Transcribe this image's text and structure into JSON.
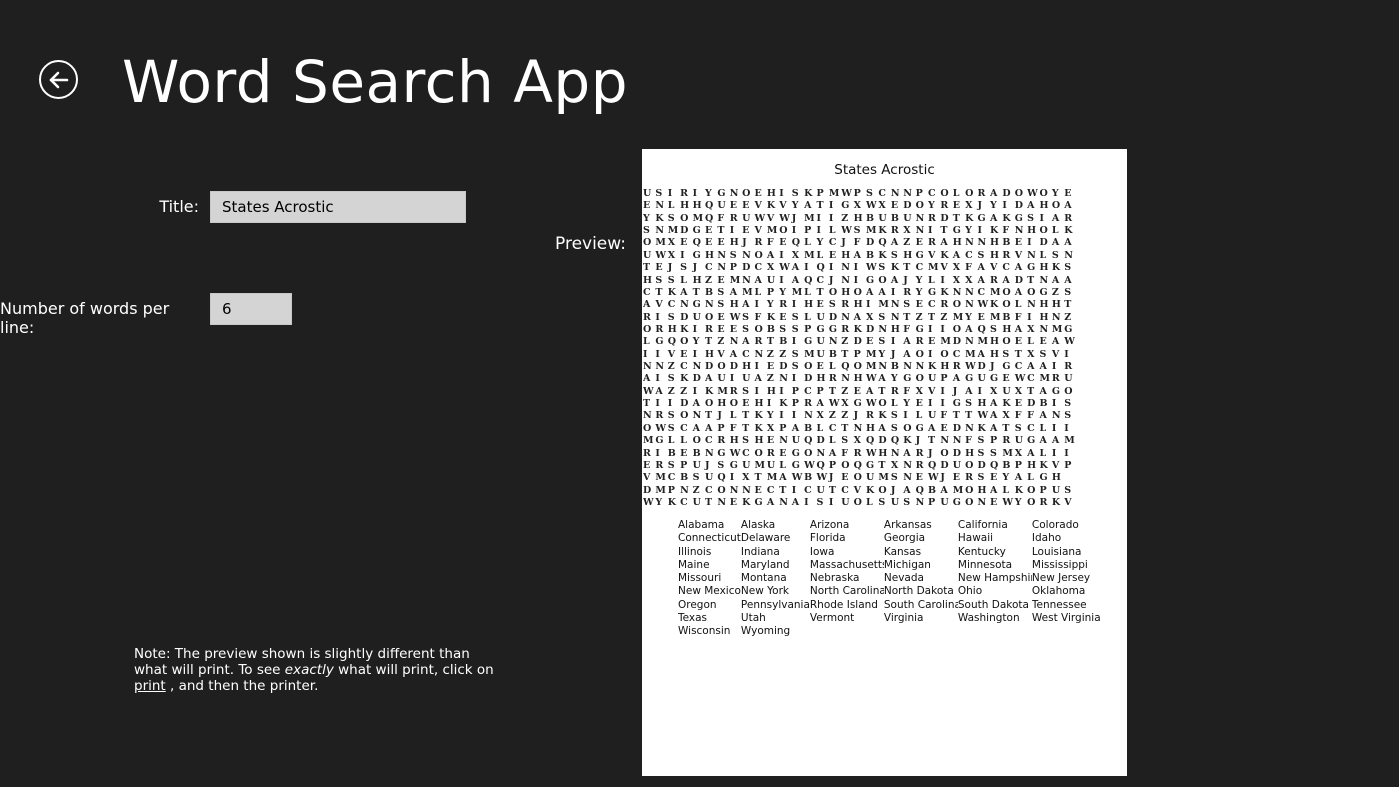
{
  "header": {
    "title": "Word Search App",
    "back_icon": "back-arrow-circle-icon"
  },
  "form": {
    "title_label": "Title:",
    "title_value": "States Acrostic",
    "words_label": "Number of words per line:",
    "words_value": "6",
    "preview_label": "Preview:"
  },
  "note": {
    "part1": "Note: The preview shown is slightly different than what will print. To see ",
    "emphasis": "exactly",
    "part2": " what will print, click on ",
    "link": "print",
    "part3": " , and then the printer."
  },
  "preview": {
    "title": "States Acrostic",
    "grid": [
      "USIRIYGNOEHISKPMWPSCNNPCOLORADOWOYE",
      "ENLHHQUEEVKVYATIGXWXEDOYREXJYIDAHOA",
      "YKSOMQFRUWVWJMIIZHBUBUNRDTKGAKGSIAR",
      "SNMDGETIEVMOIPILWSMKRXNITGYIKFNHOLK",
      "OMXEQEEHJRFEQLYCJFDQAZERAHNNHBEIDAA",
      "UWXIGHNSNOAIXMLEHABKSHGVKACSHRVNLSN",
      "TEJSJCNPDCXWAIQINIWSKTCMVXFAVCAGHKS",
      "HSSLHZEMNAUIAQCJNIGOAJYLIXXARADTNAA",
      "CTKATBSAMLPYMLTOHOAAIRYGKNNCMOAOGZS",
      "AVCNGNSHAIYRIHESRHIMNSECRONWKOLNHHT",
      "RISDUOEWSFKESLUDNAXSNTZTZMYEMBFIHNZ",
      "ORHKIREESOBSSPGGRKDNHFGIIOAQSHAXNMG",
      "LGQOYTZNARTBIGUNZDESIAREMDNMHOELEAW",
      "IIVEIHVACNZZSMUBTPMYJAOIOCMAHSTXSVI",
      "NNZCNDODHIEDSOELQOMNBNNKHRWDJGCAAIR",
      "AISKDAUIUAZNIDHRNHWAYGOUPAGUGEWCMRU",
      "WAZZIKMRSIHIPCPTZEATRFXVIJAIXUXTAGO",
      "TIIDAOHOEHIKPRAWXGWOLYEIIGSHAKEDBIS",
      "NRSONTJLTKYIINXZZJRKSILUFTTWAXFFANS",
      "OWSCAAPFTKXPABLCTNHASOGAEDNKATSCLII",
      "MGLLOCRHSHENUQDLSXQDQKJTNNFSPRUGAAM",
      "RIBEBNGWCOREGONAFRWHNARJODHSSMXALII",
      "ERSPUJSGUMULGWQPOQGTXNRQDUODQBPHKVP",
      "VMCBSUQIXTMAWBWJEOUMSNEWJERSEYALGH",
      "DMPNZCONNECTICUTCVKOJAQBAMOHALKOPUS",
      "WYKCUTNEKGANAISIUOLSUSNPUGONEWYORKV"
    ],
    "word_rows": [
      [
        "Alabama",
        "Alaska",
        "Arizona",
        "Arkansas",
        "California",
        "Colorado"
      ],
      [
        "Connecticut",
        "Delaware",
        "Florida",
        "Georgia",
        "Hawaii",
        "Idaho"
      ],
      [
        "Illinois",
        "Indiana",
        "Iowa",
        "Kansas",
        "Kentucky",
        "Louisiana"
      ],
      [
        "Maine",
        "Maryland",
        "Massachusetts",
        "Michigan",
        "Minnesota",
        "Mississippi"
      ],
      [
        "Missouri",
        "Montana",
        "Nebraska",
        "Nevada",
        "New Hampshire",
        "New Jersey"
      ],
      [
        "New Mexico",
        "New York",
        "North Carolina",
        "North Dakota",
        "Ohio",
        "Oklahoma"
      ],
      [
        "Oregon",
        "Pennsylvania",
        "Rhode Island",
        "South Carolina",
        "South Dakota",
        "Tennessee"
      ],
      [
        "Texas",
        "Utah",
        "Vermont",
        "Virginia",
        "Washington",
        "West Virginia"
      ],
      [
        "Wisconsin",
        "Wyoming",
        "",
        "",
        "",
        ""
      ]
    ]
  }
}
